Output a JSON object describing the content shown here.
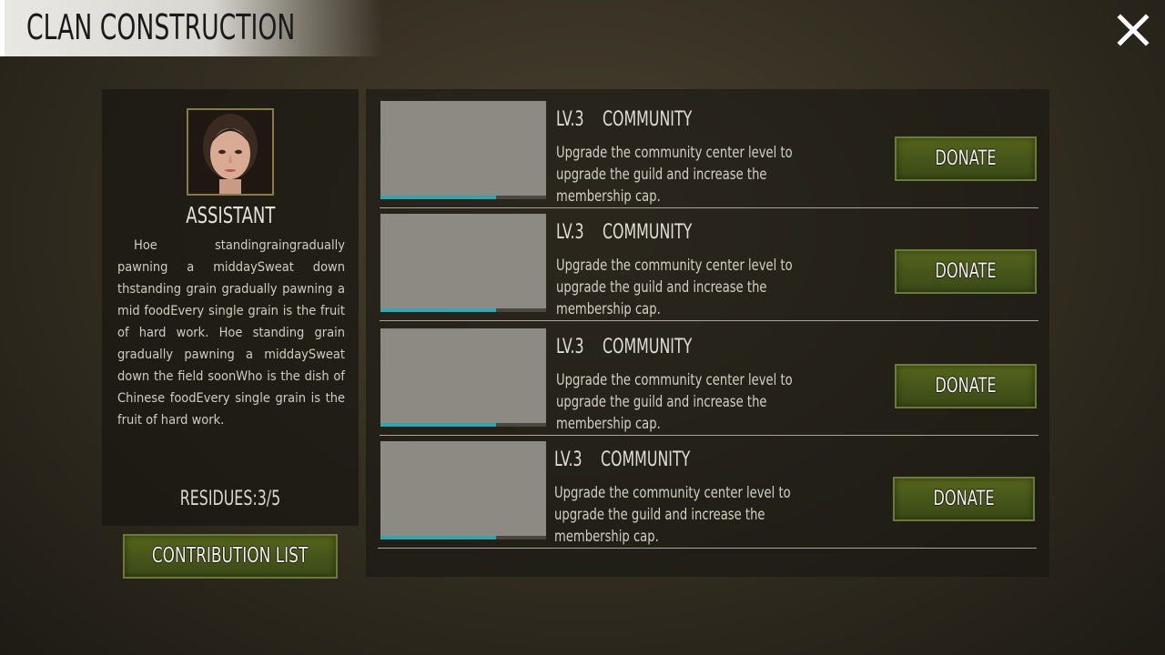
{
  "header": {
    "title": "CLAN CONSTRUCTION"
  },
  "profile": {
    "role": "ASSISTANT",
    "description": "Hoe standingraingradually pawning a middaySweat down thstanding grain gradually pawning a mid foodEvery single grain is the fruit of hard work. Hoe standing grain gradually pawning a middaySweat down the field soonWho is the dish of Chinese foodEvery single grain is the fruit of hard work.",
    "residues": "RESIDUES:3/5"
  },
  "contribution_button": "CONTRIBUTION LIST",
  "buildings": [
    {
      "level": "LV.3",
      "name": "COMMUNITY",
      "description": "Upgrade the community center level to upgrade the guild and increase the membership cap.",
      "progress": 0.7,
      "button": "DONATE"
    },
    {
      "level": "LV.3",
      "name": "COMMUNITY",
      "description": "Upgrade the community center level to upgrade the guild and increase the membership cap.",
      "progress": 0.7,
      "button": "DONATE"
    },
    {
      "level": "LV.3",
      "name": "COMMUNITY",
      "description": "Upgrade the community center level to upgrade the guild and increase the membership cap.",
      "progress": 0.7,
      "button": "DONATE"
    },
    {
      "level": "LV.3",
      "name": "COMMUNITY",
      "description": "Upgrade the community center level to upgrade the guild and increase the membership cap.",
      "progress": 0.7,
      "button": "DONATE"
    }
  ],
  "icons": {
    "close": "close-icon",
    "avatar": "avatar-portrait"
  },
  "colors": {
    "button": "#4b5b1a",
    "progress": "#2fa6b0",
    "thumbnail": "#8c8a82"
  }
}
